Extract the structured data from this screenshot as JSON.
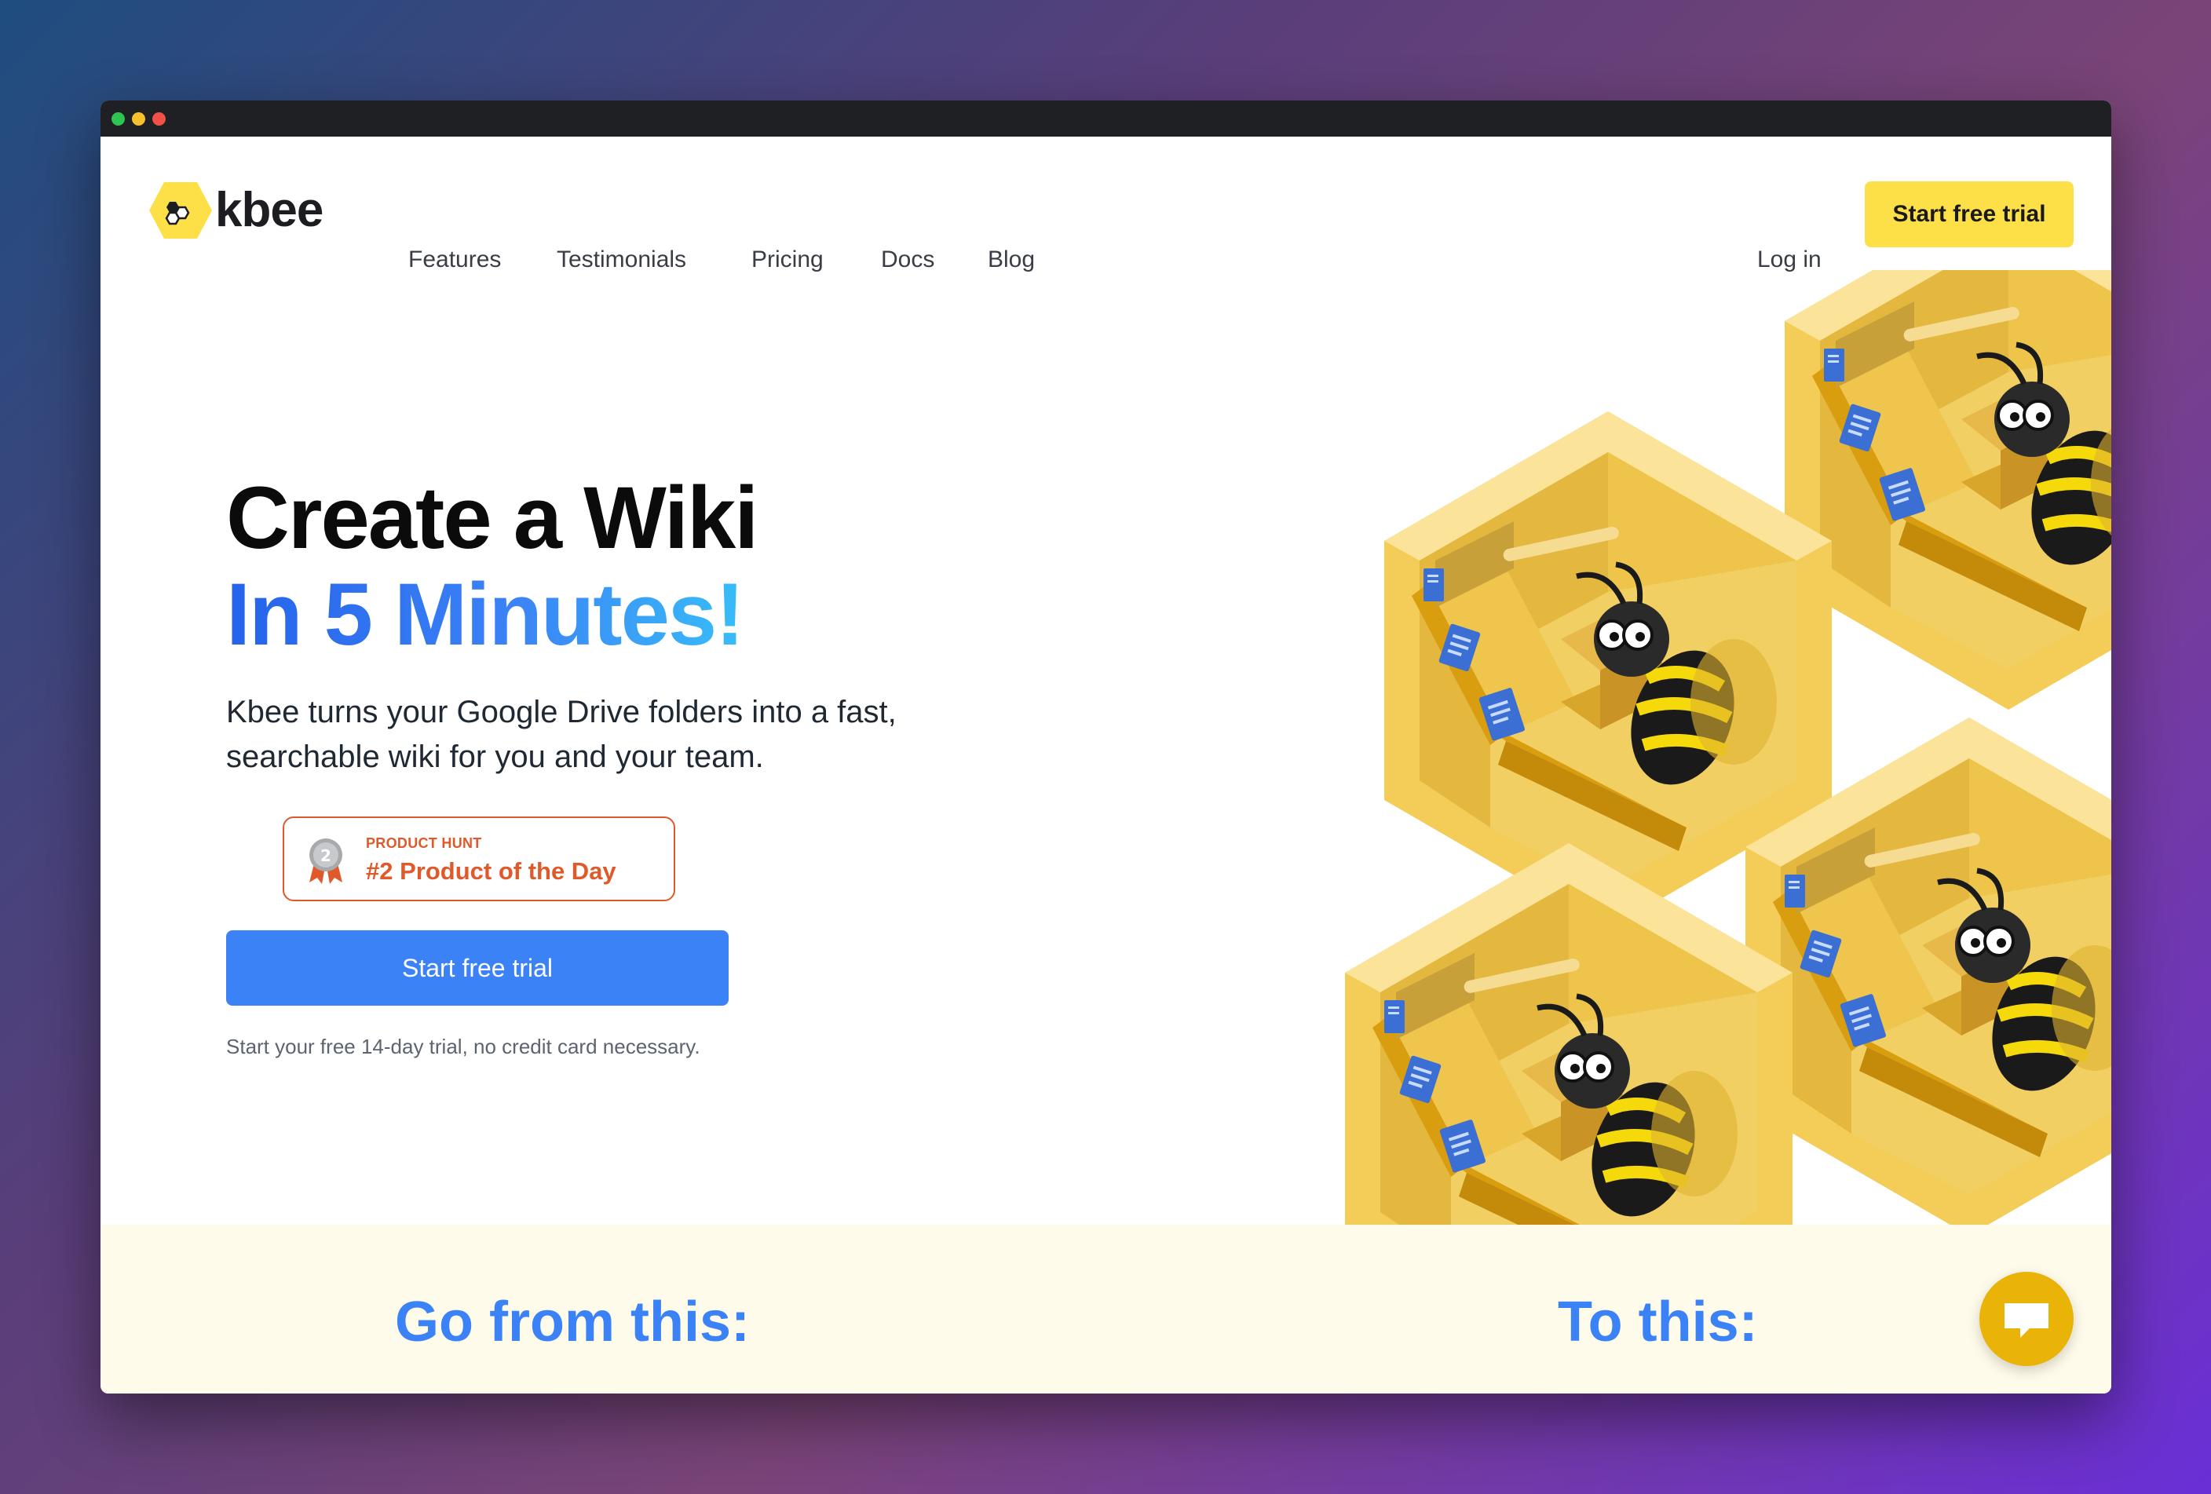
{
  "brand": {
    "name": "kbee",
    "accent_yellow": "#fde047",
    "accent_blue": "#3b82f6",
    "badge_orange": "#e0592a"
  },
  "nav": {
    "links": [
      "Features",
      "Testimonials",
      "Pricing",
      "Docs",
      "Blog"
    ],
    "login_label": "Log in",
    "cta_label": "Start free trial"
  },
  "hero": {
    "title_line_1": "Create a Wiki",
    "title_line_2": "In 5 Minutes!",
    "subtitle": "Kbee turns your Google Drive folders into a fast, searchable wiki for you and your team.",
    "badge": {
      "label": "PRODUCT HUNT",
      "title": "#2 Product of the Day",
      "medal_number": "2"
    },
    "cta_label": "Start free trial",
    "note": "Start your free 14-day trial, no credit card necessary."
  },
  "comparison": {
    "left_heading": "Go from this:",
    "right_heading": "To this:"
  },
  "icons": {
    "logo": "bee-hexagon-icon",
    "medal": "silver-medal-icon",
    "chat": "chat-bubble-icon"
  }
}
